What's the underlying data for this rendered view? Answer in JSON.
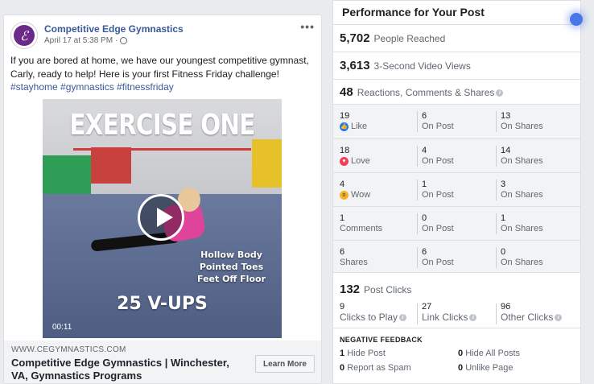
{
  "post": {
    "page_name": "Competitive Edge Gymnastics",
    "date": "April 17 at 5:38 PM",
    "separator": "·",
    "more": "•••",
    "avatar_letter": "ℰ",
    "text": "If you are bored at home, we have our youngest competitive gymnast, Carly, ready to help! Here is your first Fitness Friday challenge!",
    "hashtags": "#stayhome #gymnastics #fitnessfriday",
    "video": {
      "title": "EXERCISE ONE",
      "cue_1": "Hollow Body",
      "cue_2": "Pointed Toes",
      "cue_3": "Feet Off Floor",
      "reps": "25 V-UPS",
      "time": "00:11"
    },
    "link": {
      "domain": "WWW.CEGYMNASTICS.COM",
      "title": "Competitive Edge Gymnastics | Winchester, VA, Gymnastics Programs",
      "button": "Learn More"
    }
  },
  "performance": {
    "title": "Performance for Your Post",
    "people_reached": {
      "value": "5,702",
      "label": "People Reached"
    },
    "video_views": {
      "value": "3,613",
      "label": "3-Second Video Views"
    },
    "engagement": {
      "value": "48",
      "label": "Reactions, Comments & Shares"
    },
    "breakdown": [
      {
        "total": "19",
        "name": "Like",
        "icon": "like-icon",
        "on_post": "6",
        "on_shares": "13"
      },
      {
        "total": "18",
        "name": "Love",
        "icon": "love-icon",
        "on_post": "4",
        "on_shares": "14"
      },
      {
        "total": "4",
        "name": "Wow",
        "icon": "wow-icon",
        "on_post": "1",
        "on_shares": "3"
      },
      {
        "total": "1",
        "name": "Comments",
        "icon": "",
        "on_post": "0",
        "on_shares": "1"
      },
      {
        "total": "6",
        "name": "Shares",
        "icon": "",
        "on_post": "6",
        "on_shares": "0"
      }
    ],
    "on_post_label": "On Post",
    "on_shares_label": "On Shares",
    "post_clicks": {
      "value": "132",
      "label": "Post Clicks"
    },
    "clicks_breakdown": [
      {
        "value": "9",
        "label": "Clicks to Play"
      },
      {
        "value": "27",
        "label": "Link Clicks"
      },
      {
        "value": "96",
        "label": "Other Clicks"
      }
    ],
    "negative_feedback": {
      "title": "NEGATIVE FEEDBACK",
      "items": [
        {
          "value": "1",
          "label": "Hide Post"
        },
        {
          "value": "0",
          "label": "Hide All Posts"
        },
        {
          "value": "0",
          "label": "Report as Spam"
        },
        {
          "value": "0",
          "label": "Unlike Page"
        }
      ]
    }
  },
  "colors": {
    "link_blue": "#385898",
    "like": "#2078f4",
    "love": "#f33e58",
    "wow": "#f7b125"
  }
}
